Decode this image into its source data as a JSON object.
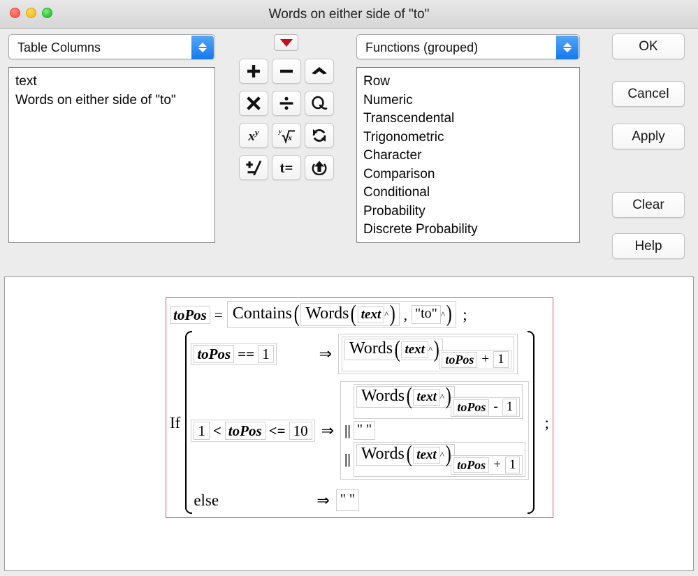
{
  "window": {
    "title": "Words on either side of \"to\"",
    "traffic_lights": [
      "close-button",
      "minimize-button",
      "maximize-button"
    ]
  },
  "left_panel": {
    "combo_label": "Table Columns",
    "items": [
      "text",
      "Words on either side of \"to\""
    ]
  },
  "right_panel": {
    "combo_label": "Functions (grouped)",
    "items": [
      "Row",
      "Numeric",
      "Transcendental",
      "Trigonometric",
      "Character",
      "Comparison",
      "Conditional",
      "Probability",
      "Discrete Probability"
    ]
  },
  "keypad": {
    "menu_icon": "red-triangle-menu-icon",
    "buttons": [
      {
        "name": "plus-button",
        "icon": "plus-icon",
        "glyph": "+"
      },
      {
        "name": "minus-button",
        "icon": "minus-icon",
        "glyph": "−"
      },
      {
        "name": "exponent-button",
        "icon": "caret-up-icon",
        "glyph": "^"
      },
      {
        "name": "multiply-button",
        "icon": "multiply-icon",
        "glyph": "✕"
      },
      {
        "name": "divide-button",
        "icon": "divide-icon",
        "glyph": "÷"
      },
      {
        "name": "root-loop-button",
        "icon": "loop-icon",
        "glyph": "ↄ"
      },
      {
        "name": "power-button",
        "icon": "x-to-the-y-icon",
        "glyph": "xʸ"
      },
      {
        "name": "nth-root-button",
        "icon": "nth-root-icon",
        "glyph": "ⁿ√x"
      },
      {
        "name": "refresh-button",
        "icon": "refresh-icon",
        "glyph": "↻"
      },
      {
        "name": "sign-toggle-button",
        "icon": "plus-over-minus-icon",
        "glyph": "±"
      },
      {
        "name": "ttest-button",
        "icon": "t-equals-icon",
        "glyph": "t="
      },
      {
        "name": "insert-button",
        "icon": "up-arrow-in-circle-icon",
        "glyph": "⬆"
      }
    ]
  },
  "actions": [
    {
      "name": "ok-button",
      "label": "OK"
    },
    {
      "name": "cancel-button",
      "label": "Cancel"
    },
    {
      "name": "apply-button",
      "label": "Apply"
    },
    {
      "name": "clear-button",
      "label": "Clear"
    },
    {
      "name": "help-button",
      "label": "Help"
    }
  ],
  "formula": {
    "highlight_color": "#f0475e",
    "statement1": {
      "assign_var": "toPos",
      "equals": "=",
      "function": "Contains",
      "arg1_function": "Words",
      "arg1_arg": "text",
      "comma": ",",
      "arg2": "\"to\"",
      "terminator": ";"
    },
    "statement2": {
      "keyword": "If",
      "terminator": ";",
      "arrow": "⇒",
      "or_operator": "||",
      "clauses": [
        {
          "condition": {
            "lhs": "toPos",
            "op": "==",
            "rhs": "1"
          },
          "result": [
            {
              "kind": "subscript",
              "function": "Words",
              "arg": "text",
              "index_var": "toPos",
              "index_op": "+",
              "index_num": "1"
            }
          ]
        },
        {
          "condition": {
            "lhs": "1",
            "op1": "<",
            "mid": "toPos",
            "op2": "<=",
            "rhs": "10"
          },
          "result": [
            {
              "kind": "subscript",
              "function": "Words",
              "arg": "text",
              "index_var": "toPos",
              "index_op": "-",
              "index_num": "1"
            },
            {
              "kind": "string",
              "value": "\" \""
            },
            {
              "kind": "subscript",
              "function": "Words",
              "arg": "text",
              "index_var": "toPos",
              "index_op": "+",
              "index_num": "1"
            }
          ]
        },
        {
          "condition_label": "else",
          "result": [
            {
              "kind": "string",
              "value": "\" \""
            }
          ]
        }
      ]
    }
  }
}
